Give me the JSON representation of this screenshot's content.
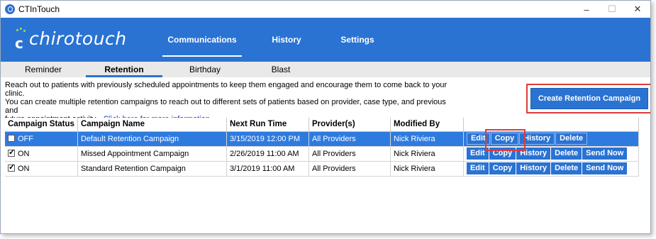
{
  "window": {
    "title": "CTInTouch",
    "controls": [
      "–",
      "☐",
      "✕"
    ]
  },
  "header": {
    "logo": "chirotouch",
    "nav": [
      {
        "label": "Communications",
        "active": true
      },
      {
        "label": "History",
        "active": false
      },
      {
        "label": "Settings",
        "active": false
      }
    ]
  },
  "subtabs": [
    {
      "label": "Reminder",
      "active": false
    },
    {
      "label": "Retention",
      "active": true
    },
    {
      "label": "Birthday",
      "active": false
    },
    {
      "label": "Blast",
      "active": false
    }
  ],
  "description": {
    "line1": "Reach out to patients with previously scheduled appointments to keep them engaged and encourage them to come back to your clinic.",
    "line2": "You can create multiple retention campaigns to reach out to different sets of patients based on provider, case type, and previous and",
    "line3": "future appointment activity.",
    "link": "Click here for more information."
  },
  "create_button": "Create Retention Campaign",
  "table": {
    "columns": [
      "Campaign Status",
      "Campaign Name",
      "Next Run Time",
      "Provider(s)",
      "Modified By",
      ""
    ],
    "rows": [
      {
        "checked": false,
        "status": "OFF",
        "name": "Default Retention Campaign",
        "next_run": "3/15/2019 12:00 PM",
        "providers": "All Providers",
        "modified_by": "Nick Riviera",
        "selected": true,
        "actions": [
          "Edit",
          "Copy",
          "History",
          "Delete"
        ]
      },
      {
        "checked": true,
        "status": "ON",
        "name": "Missed Appointment Campaign",
        "next_run": "2/26/2019 11:00 AM",
        "providers": "All Providers",
        "modified_by": "Nick Riviera",
        "selected": false,
        "actions": [
          "Edit",
          "Copy",
          "History",
          "Delete",
          "Send Now"
        ]
      },
      {
        "checked": true,
        "status": "ON",
        "name": "Standard Retention Campaign",
        "next_run": "3/1/2019 11:00 AM",
        "providers": "All Providers",
        "modified_by": "Nick Riviera",
        "selected": false,
        "actions": [
          "Edit",
          "Copy",
          "History",
          "Delete",
          "Send Now"
        ]
      }
    ]
  },
  "colors": {
    "brand_blue": "#2a73d3",
    "highlight_red": "#e03b3b",
    "accent_green": "#9fe04a"
  }
}
